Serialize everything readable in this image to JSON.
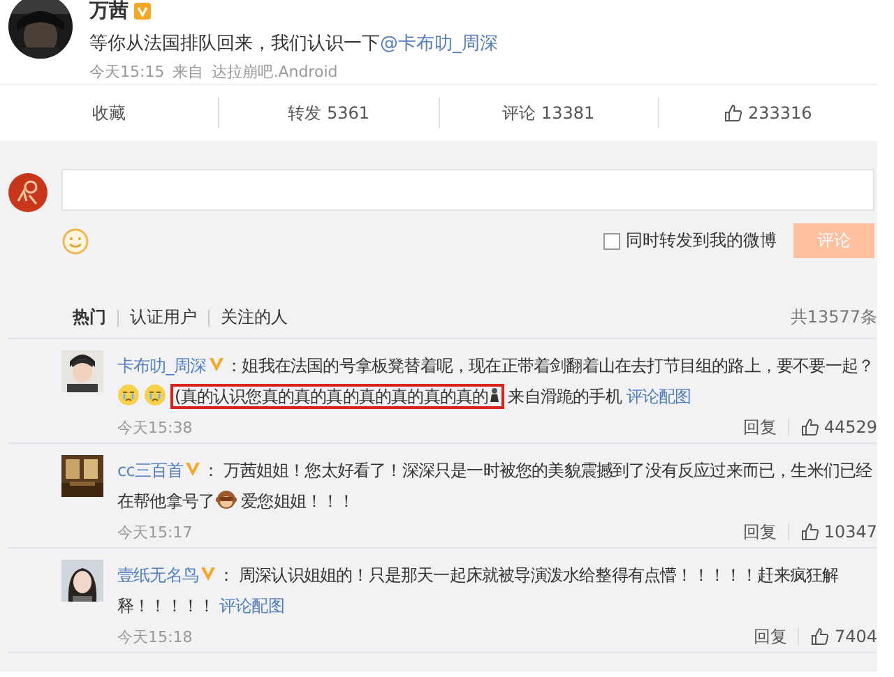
{
  "post": {
    "author": "万茜",
    "verified": true,
    "segments": [
      {
        "kind": "text",
        "text": "等你从法国排队回来，我们认识一下"
      },
      {
        "kind": "link",
        "text": "@卡布叻_周深"
      }
    ],
    "time": "今天15:15",
    "source_prefix": "来自",
    "source": "达拉崩吧.Android"
  },
  "actions": [
    {
      "kind": "plain",
      "label": "收藏"
    },
    {
      "kind": "plain",
      "label": "转发 5361"
    },
    {
      "kind": "plain",
      "label": "评论 13381"
    },
    {
      "kind": "like",
      "label": "233316"
    }
  ],
  "composer": {
    "repost_label": "同时转发到我的微博",
    "repost_checked": false,
    "submit": "评论",
    "submit_disabled": true
  },
  "tabs": [
    {
      "label": "热门",
      "selected": true
    },
    {
      "label": "认证用户",
      "selected": false
    },
    {
      "label": "关注的人",
      "selected": false
    }
  ],
  "total": "共13577条",
  "comments": [
    {
      "user": "卡布叻_周深",
      "verified": true,
      "segments": [
        {
          "kind": "text",
          "text": "：姐我在法国的号拿板凳替着呢，现在正带着剑翻着山在去打节目组的路上，要不要一起？"
        },
        {
          "kind": "emoji"
        },
        {
          "kind": "emoji"
        },
        {
          "kind": "highlight",
          "text": "(真的认识您真的真的真的真的真的真的真的"
        },
        {
          "kind": "text",
          "text": "来自滑跪的手机 "
        },
        {
          "kind": "link",
          "text": "评论配图"
        }
      ],
      "time": "今天15:38",
      "reply": "回复",
      "likes": "44529"
    },
    {
      "user": "cc三百首",
      "verified": true,
      "segments": [
        {
          "kind": "text",
          "text": "：  万茜姐姐！您太好看了！深深只是一时被您的美貌震撼到了没有反应过来而已，生米们已经在帮他拿号了"
        },
        {
          "kind": "monkey"
        },
        {
          "kind": "text",
          "text": "爱您姐姐！！！"
        }
      ],
      "time": "今天15:17",
      "reply": "回复",
      "likes": "10347"
    },
    {
      "user": "壹纸无名鸟",
      "verified": true,
      "segments": [
        {
          "kind": "text",
          "text": "：  周深认识姐姐的！只是那天一起床就被导演泼水给整得有点懵！！！！！赶来疯狂解释！！！！！ "
        },
        {
          "kind": "link",
          "text": "评论配图"
        }
      ],
      "time": "今天15:18",
      "reply": "回复",
      "likes": "7404"
    }
  ]
}
